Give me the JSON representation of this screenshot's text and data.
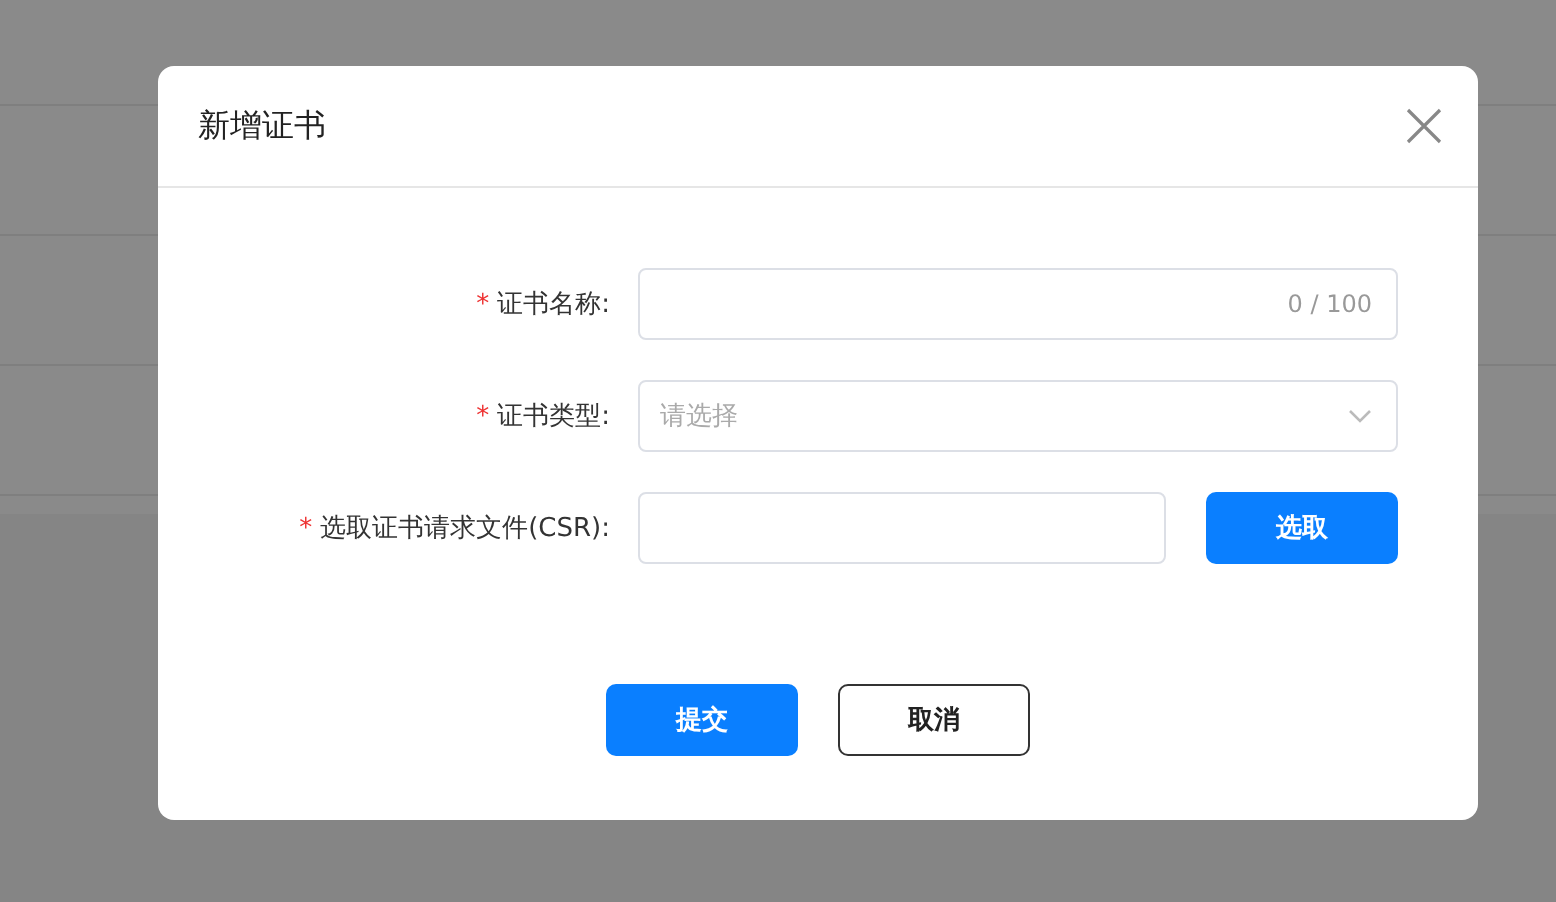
{
  "dialog": {
    "title": "新增证书",
    "fields": [
      {
        "kind": "text",
        "required_mark": "*",
        "label": "证书名称:",
        "counter": "0 / 100"
      },
      {
        "kind": "select",
        "required_mark": "*",
        "label": "证书类型:",
        "placeholder": "请选择"
      },
      {
        "kind": "file",
        "required_mark": "*",
        "label": "选取证书请求文件(CSR):",
        "button": "选取"
      }
    ],
    "buttons": [
      {
        "label": "提交",
        "primary": true
      },
      {
        "label": "取消",
        "primary": false
      }
    ]
  }
}
